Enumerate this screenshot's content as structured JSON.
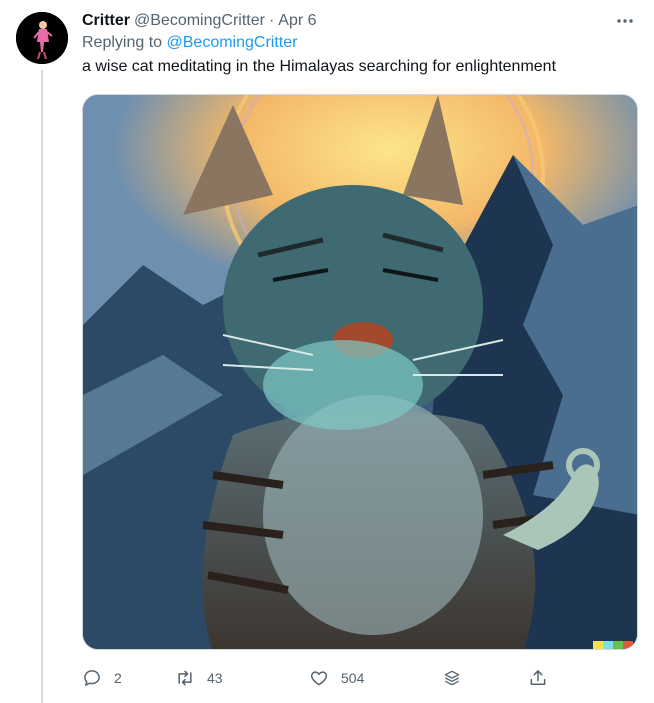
{
  "tweet": {
    "author_name": "Critter",
    "author_handle": "@BecomingCritter",
    "separator": "·",
    "date": "Apr 6",
    "reply_prefix": "Replying to ",
    "reply_to": "@BecomingCritter",
    "text": "a wise cat meditating in the Himalayas searching for enlightenment"
  },
  "actions": {
    "reply_count": "2",
    "retweet_count": "43",
    "like_count": "504"
  },
  "icons": {
    "more": "more-horizontal-icon",
    "reply": "reply-icon",
    "retweet": "retweet-icon",
    "like": "heart-icon",
    "stack": "layers-icon",
    "share": "share-icon"
  },
  "colors": {
    "link": "#1d9bf0",
    "secondary_text": "#536471",
    "primary_text": "#0f1419"
  }
}
